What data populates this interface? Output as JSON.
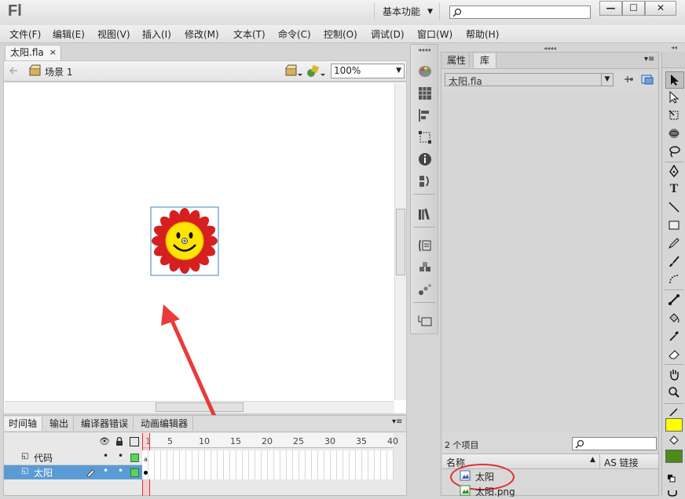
{
  "app": {
    "logo": "Fl"
  },
  "titlebar": {
    "workspace": "基本功能",
    "search_placeholder": "",
    "minimize": "—",
    "maximize": "☐",
    "close": "✕"
  },
  "menu": [
    "文件(F)",
    "编辑(E)",
    "视图(V)",
    "插入(I)",
    "修改(M)",
    "文本(T)",
    "命令(C)",
    "控制(O)",
    "调试(D)",
    "窗口(W)",
    "帮助(H)"
  ],
  "document": {
    "tab": "太阳.fla",
    "tab_close": "×"
  },
  "editbar": {
    "scene": "场景 1",
    "zoom": "100%"
  },
  "timeline": {
    "tabs": [
      "时间轴",
      "输出",
      "编译器错误",
      "动画编辑器"
    ],
    "frame_numbers": [
      "1",
      "5",
      "10",
      "15",
      "20",
      "25",
      "30",
      "35",
      "40"
    ],
    "layers": [
      {
        "name": "代码"
      },
      {
        "name": "太阳"
      }
    ]
  },
  "library": {
    "tabs": [
      "属性",
      "库"
    ],
    "file": "太阳.fla",
    "item_count": "2 个项目",
    "columns": {
      "name": "名称",
      "linkage": "AS 链接"
    },
    "items": [
      {
        "name": "太阳"
      },
      {
        "name": "太阳.png"
      }
    ]
  },
  "colors": {
    "stroke": "#000000",
    "fill": "#ffff00",
    "accent_highlight": "#5b9bd5"
  }
}
